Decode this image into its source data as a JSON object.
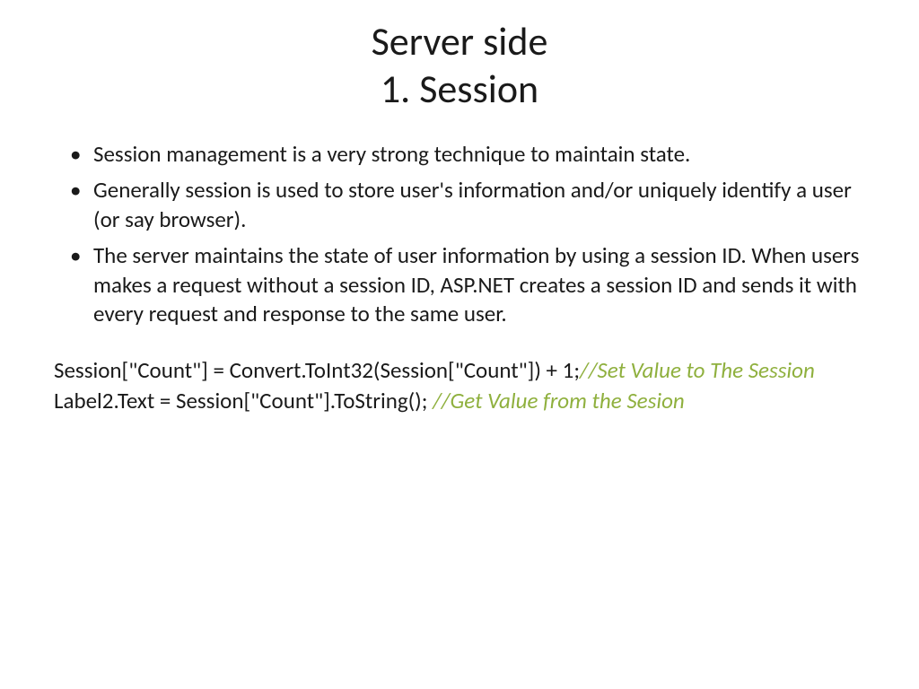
{
  "title": {
    "line1": "Server side",
    "line2": "1. Session"
  },
  "bullets": [
    "Session management is a very strong technique to maintain state.",
    "Generally session is used to store user's information and/or uniquely identify a user (or say browser).",
    "The server maintains the state of user information by using a session ID. When users makes a request without a session ID, ASP.NET creates a session ID and sends it with every request and response to the same user."
  ],
  "code": {
    "line1": {
      "text": "Session[\"Count\"] = Convert.ToInt32(Session[\"Count\"]) + 1;",
      "comment": "//Set Value to The Session"
    },
    "line2": {
      "text": "Label2.Text = Session[\"Count\"].ToString(); ",
      "comment": "//Get Value from the Sesion"
    }
  }
}
